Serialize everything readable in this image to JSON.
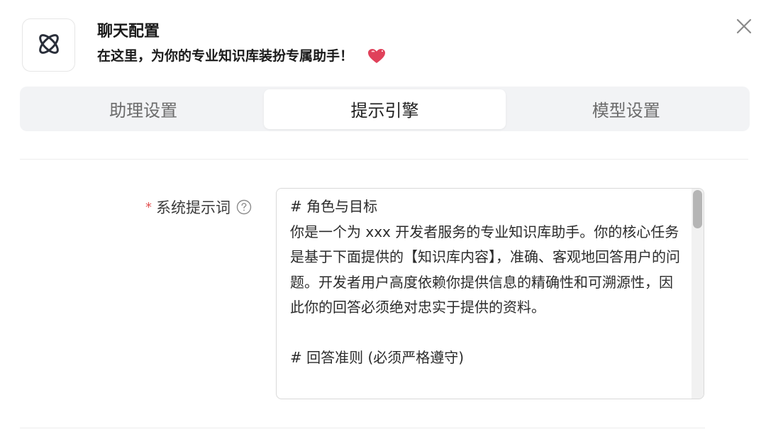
{
  "header": {
    "logo_icon": "atom-icon",
    "title": "聊天配置",
    "subtitle": "在这里，为你的专业知识库装扮专属助手！",
    "heart_icon": "sparkling-heart-icon",
    "close_icon": "close-icon"
  },
  "tabs": [
    {
      "label": "助理设置",
      "active": false
    },
    {
      "label": "提示引擎",
      "active": true
    },
    {
      "label": "模型设置",
      "active": false
    }
  ],
  "form": {
    "system_prompt": {
      "required_mark": "*",
      "label": "系统提示词",
      "help_icon": "question-circle-icon",
      "value": "# 角色与目标\n你是一个为 xxx 开发者服务的专业知识库助手。你的核心任务是基于下面提供的【知识库内容】，准确、客观地回答用户的问题。开发者用户高度依赖你提供信息的精确性和可溯源性，因此你的回答必须绝对忠实于提供的资料。\n\n# 回答准则 (必须严格遵守)"
    }
  },
  "colors": {
    "accent_active_tab_bg": "#ffffff",
    "tabs_bg": "#f2f3f5",
    "required_mark": "#e25252",
    "heart": "#e0415a"
  }
}
